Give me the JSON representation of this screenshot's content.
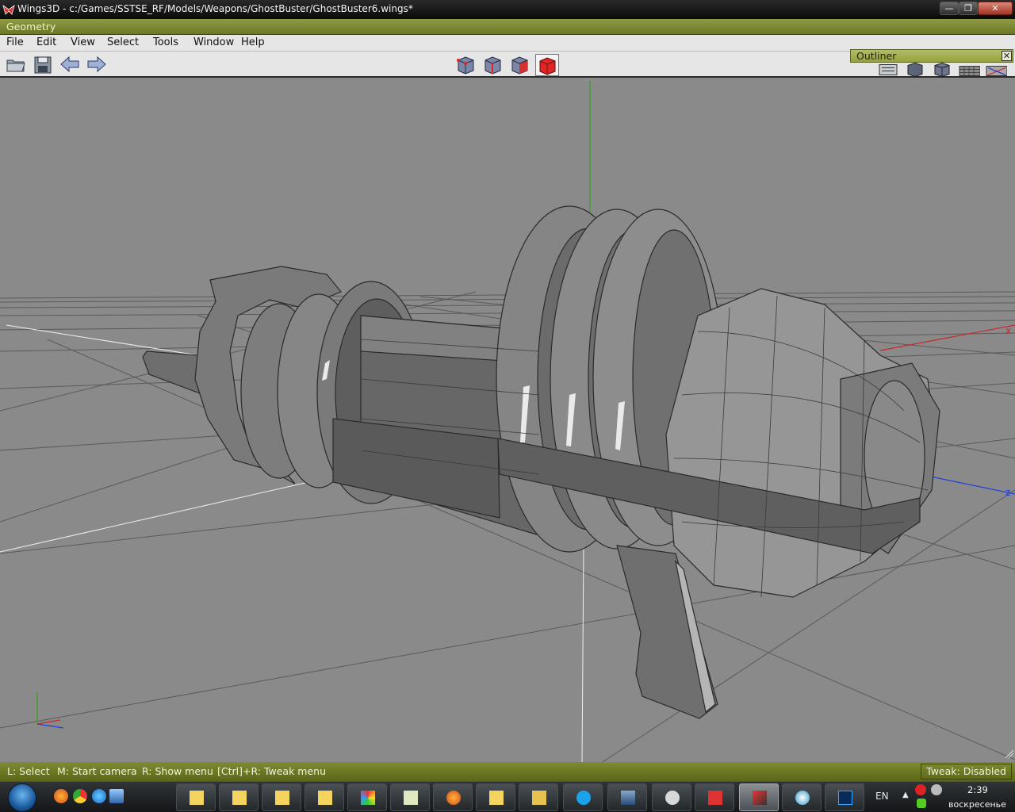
{
  "window": {
    "title": "Wings3D - c:/Games/SSTSE_RF/Models/Weapons/GhostBuster/GhostBuster6.wings*",
    "min_label": "—",
    "max_label": "❐",
    "close_label": "✕"
  },
  "geometry_bar": {
    "label": "Geometry"
  },
  "menu": [
    "File",
    "Edit",
    "View",
    "Select",
    "Tools",
    "Window",
    "Help"
  ],
  "toolbar": {
    "left_icons": [
      "open-folder-icon",
      "save-icon",
      "undo-arrow-icon",
      "redo-arrow-icon"
    ],
    "selection_modes": [
      "vertex-mode-icon",
      "edge-mode-icon",
      "face-mode-icon",
      "body-mode-icon"
    ],
    "active_mode": "body-mode-icon",
    "right_icons": [
      "ortho-view-icon",
      "smooth-shade-icon",
      "wireframe-shade-icon",
      "groundplane-icon",
      "axes-icon"
    ]
  },
  "outliner": {
    "title": "Outliner",
    "close_label": "✕"
  },
  "viewport": {
    "background": "#8a8a8a",
    "axis_colors": {
      "x": "#c8282a",
      "y": "#3aa020",
      "z": "#2040d8"
    },
    "axis_labels": {
      "x": "x",
      "z": "z"
    }
  },
  "status": {
    "hints": [
      "L: Select",
      "M: Start camera",
      "R: Show menu",
      "[Ctrl]+R: Tweak menu"
    ],
    "tweak": "Tweak: Disabled"
  },
  "taskbar": {
    "quick_launch": [
      "firefox-icon",
      "chrome-icon",
      "ie-icon",
      "desktop-icon"
    ],
    "buttons": [
      "folder-icon",
      "folder-icon",
      "folder-icon",
      "folder-icon",
      "paint-icon",
      "notepad-icon",
      "firefox-icon",
      "folder-icon",
      "folder-icon",
      "skype-icon",
      "ship-icon",
      "steam-icon",
      "app-icon",
      "wings3d-icon",
      "media-player-icon",
      "photoshop-icon"
    ],
    "active_index": 13,
    "lang": "EN",
    "time": "2:39",
    "day": "воскресенье"
  }
}
